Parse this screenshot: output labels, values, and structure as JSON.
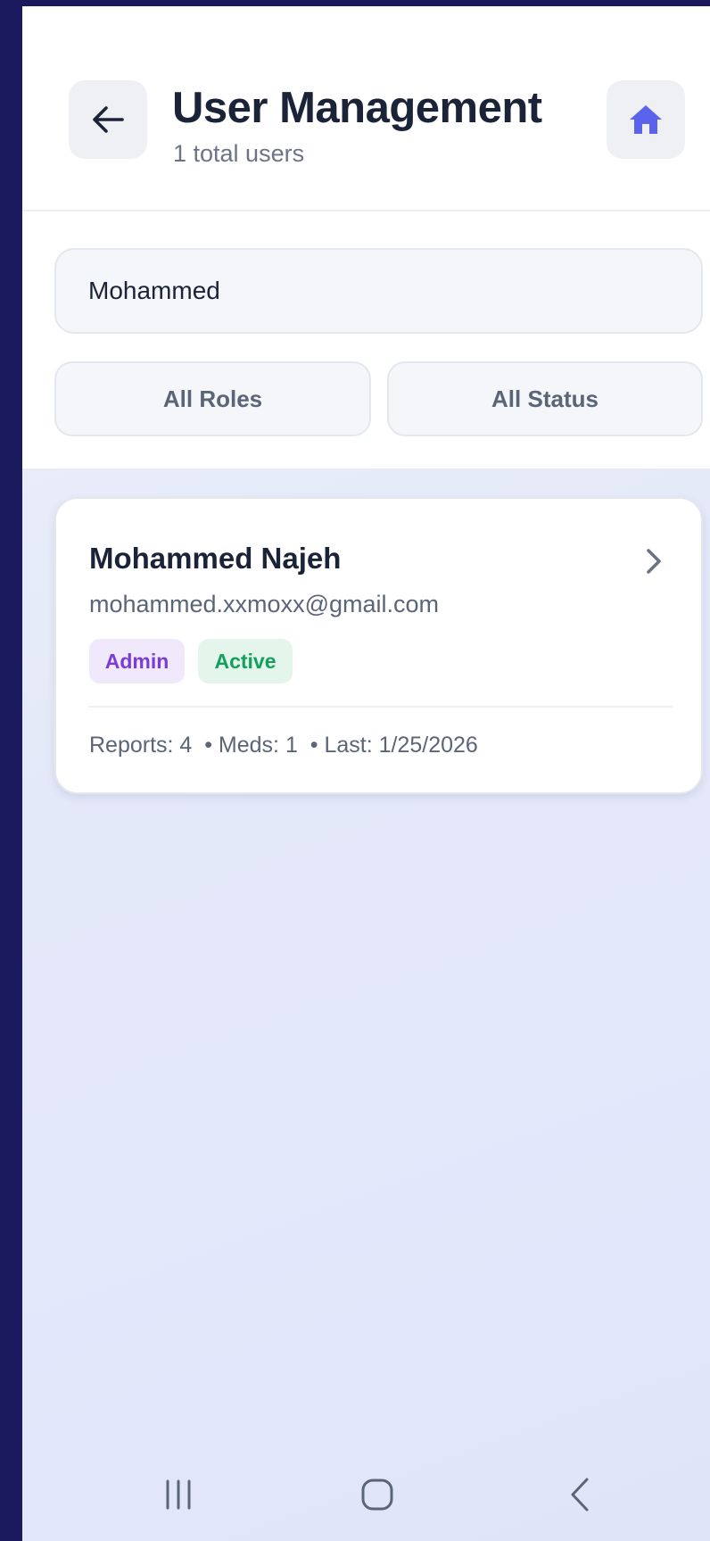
{
  "header": {
    "title": "User Management",
    "subtitle": "1 total users",
    "back_icon": "arrow-left-icon",
    "home_icon": "home-icon",
    "home_icon_color": "#5b63ec"
  },
  "filters": {
    "search_value": "Mohammed",
    "roles_label": "All Roles",
    "status_label": "All Status"
  },
  "users": [
    {
      "name": "Mohammed Najeh",
      "email": "mohammed.xxmoxx@gmail.com",
      "role": "Admin",
      "status": "Active",
      "stats": "Reports: 4  • Meds: 1  • Last: 1/25/2026"
    }
  ],
  "colors": {
    "accent": "#5b63ec",
    "admin_badge_bg": "#f0e9fb",
    "admin_badge_text": "#7c3bd6",
    "active_badge_bg": "#e4f5ec",
    "active_badge_text": "#12a05c"
  },
  "system_nav": {
    "icons": [
      "recent-apps-icon",
      "home-circle-icon",
      "back-chevron-icon"
    ]
  }
}
